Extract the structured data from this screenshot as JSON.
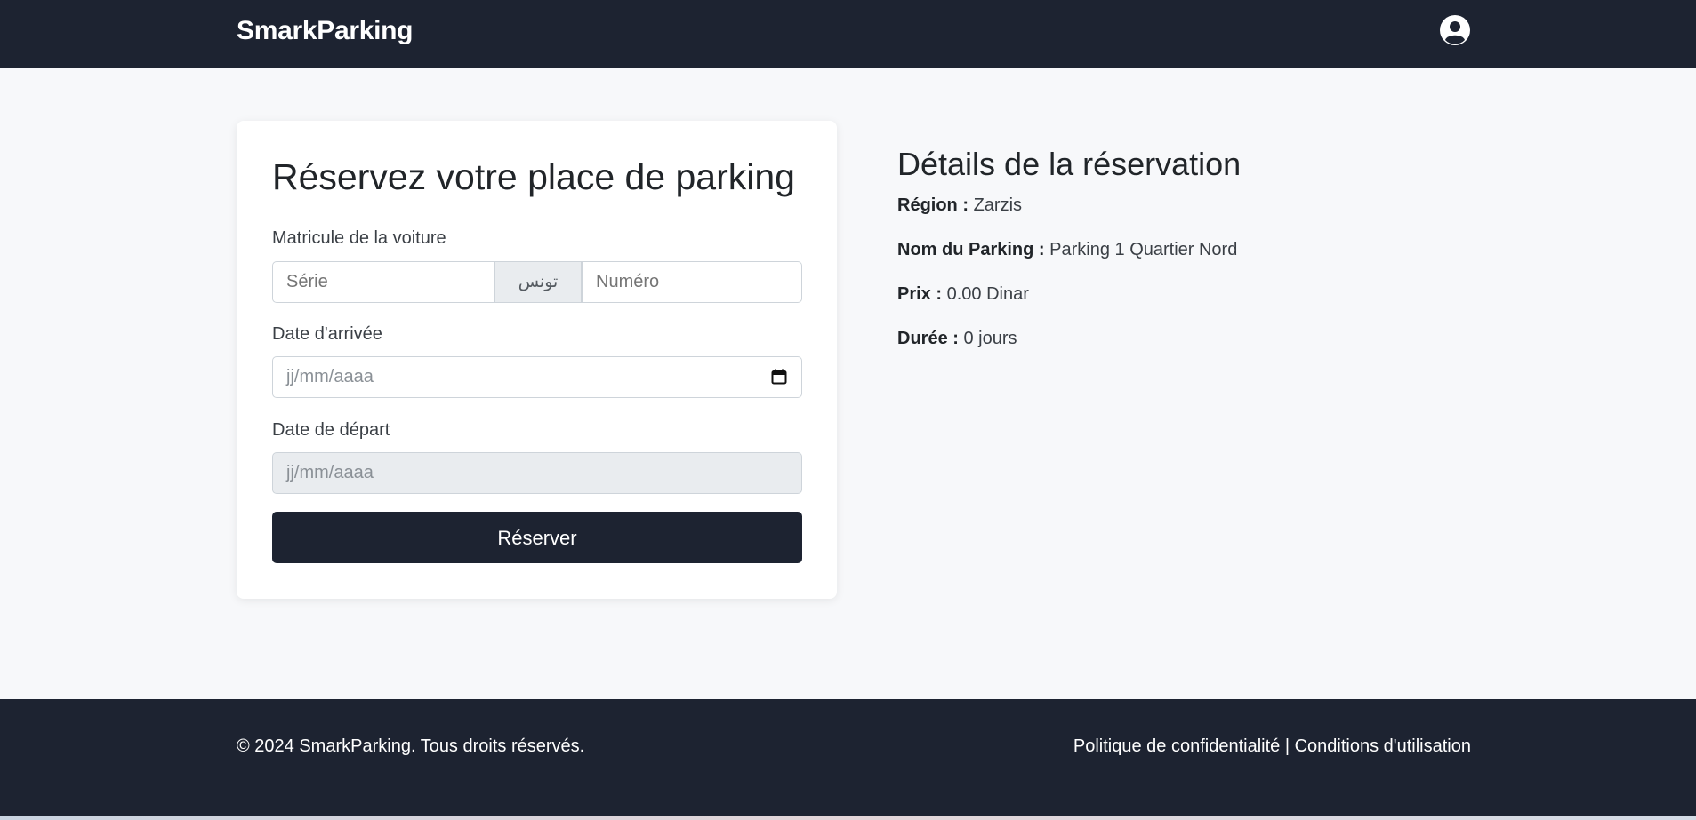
{
  "header": {
    "brand": "SmarkParking",
    "user_icon": "user-circle-icon"
  },
  "form": {
    "title": "Réservez votre place de parking",
    "plate_label": "Matricule de la voiture",
    "series_placeholder": "Série",
    "country_addon": "تونس",
    "number_placeholder": "Numéro",
    "arrival_label": "Date d'arrivée",
    "arrival_value": "jj/mm/aaaa",
    "departure_label": "Date de départ",
    "departure_value": "jj/mm/aaaa",
    "submit_label": "Réserver"
  },
  "details": {
    "title": "Détails de la réservation",
    "region_label": "Région :",
    "region_value": "Zarzis",
    "parking_label": "Nom du Parking :",
    "parking_value": "Parking 1 Quartier Nord",
    "price_label": "Prix :",
    "price_value": "0.00 Dinar",
    "duration_label": "Durée :",
    "duration_value": "0 jours"
  },
  "footer": {
    "copyright": "© 2024 SmarkParking. Tous droits réservés.",
    "privacy_link": "Politique de confidentialité",
    "separator": "|",
    "terms_link": "Conditions d'utilisation"
  },
  "colors": {
    "navbar": "#1d2331",
    "background": "#f7f8fa",
    "button": "#1d2331"
  }
}
